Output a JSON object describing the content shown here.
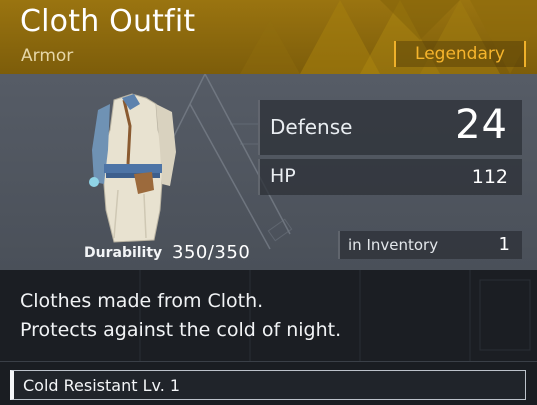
{
  "item": {
    "name": "Cloth Outfit",
    "category": "Armor",
    "rarity": "Legendary",
    "rarity_color": "#f7b52c",
    "header_color": "#8f6c0d"
  },
  "durability": {
    "label": "Durability",
    "value": "350/350"
  },
  "stats": {
    "defense": {
      "label": "Defense",
      "value": "24"
    },
    "hp": {
      "label": "HP",
      "value": "112"
    }
  },
  "inventory": {
    "label": "in Inventory",
    "value": "1"
  },
  "description": {
    "line1": "Clothes made from Cloth.",
    "line2": "Protects against the cold of night."
  },
  "traits": [
    {
      "label": "Cold Resistant Lv. 1"
    }
  ],
  "icons": {
    "item_image": "cloth-outfit-icon"
  }
}
